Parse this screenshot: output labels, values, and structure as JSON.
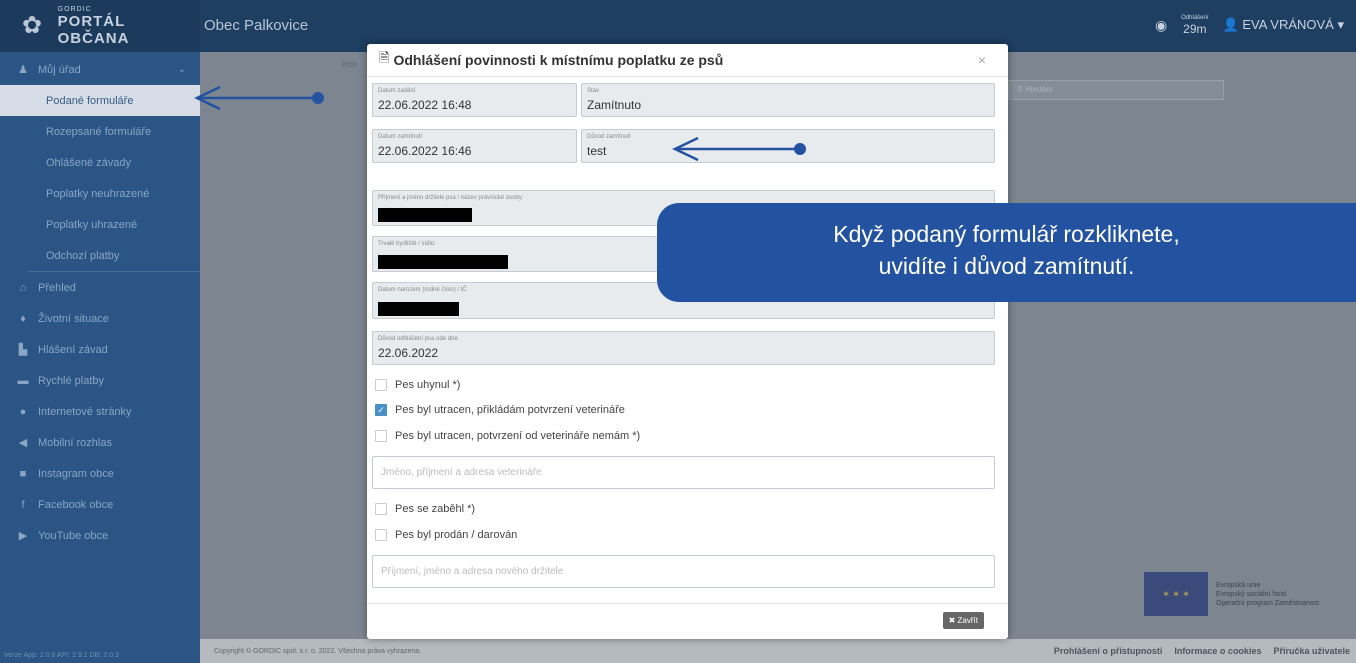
{
  "brand": {
    "small": "GORDIC",
    "name": "PORTÁL OBČANA"
  },
  "header": {
    "town": "Obec Palkovice",
    "timer_label": "Odhlášení",
    "timer_value": "29m",
    "user": "EVA VRÁNOVÁ"
  },
  "sidebar": {
    "items": [
      {
        "icon": "user-icon",
        "label": "Můj úřad"
      },
      {
        "label": "Podané formuláře"
      },
      {
        "label": "Rozepsané formuláře"
      },
      {
        "label": "Ohlášené závady"
      },
      {
        "label": "Poplatky neuhrazené"
      },
      {
        "label": "Poplatky uhrazené"
      },
      {
        "label": "Odchozí platby"
      },
      {
        "icon": "home-icon",
        "label": "Přehled"
      },
      {
        "icon": "lightbulb-icon",
        "label": "Životní situace"
      },
      {
        "icon": "bulldozer-icon",
        "label": "Hlášení závad"
      },
      {
        "icon": "card-icon",
        "label": "Rychlé platby"
      },
      {
        "icon": "globe-icon",
        "label": "Internetové stránky"
      },
      {
        "icon": "megaphone-icon",
        "label": "Mobilní rozhlas"
      },
      {
        "icon": "camera-icon",
        "label": "Instagram obce"
      },
      {
        "icon": "facebook-icon",
        "label": "Facebook obce"
      },
      {
        "icon": "youtube-icon",
        "label": "YouTube obce"
      }
    ],
    "version": "Verze App: 2.0.8 API: 2.9.1 DB: 2.0.3"
  },
  "main": {
    "crumb": "POD",
    "search_placeholder": "Hledání"
  },
  "modal": {
    "title": "Odhlášení povinnosti k místnímu poplatku ze psů",
    "close": "×",
    "date_submitted_label": "Datum zadání",
    "date_submitted": "22.06.2022 16:48",
    "state_label": "Stav",
    "state": "Zamítnuto",
    "date_rejected_label": "Datum zamítnutí",
    "date_rejected": "22.06.2022 16:46",
    "reason_label": "Důvod zamítnutí",
    "reason": "test",
    "owner_label": "Příjmení a jméno držitele psa / název právnické osoby:",
    "address_label": "Trvalé bydliště / sídlo:",
    "birth_label": "Datum narození (rodné číslo) / IČ",
    "dereg_label": "Důvod odhlášení psa ode dne",
    "dereg_date": "22.06.2022",
    "options": [
      {
        "label": "Pes uhynul *)",
        "checked": false
      },
      {
        "label": "Pes byl utracen, přikládám potvrzení veterináře",
        "checked": true
      },
      {
        "label": "Pes byl utracen, potvrzení od veterináře nemám *)",
        "checked": false
      }
    ],
    "vet_placeholder": "Jméno, příjmení a adresa veterináře",
    "options2": [
      {
        "label": "Pes se zaběhl *)",
        "checked": false
      },
      {
        "label": "Pes byl prodán / darován",
        "checked": false
      }
    ],
    "new_owner_placeholder": "Příjmení, jméno a adresa nového držitele",
    "close_button": "Zavřít"
  },
  "callout": {
    "line1": "Když podaný formulář rozkliknete,",
    "line2": "uvidíte i důvod zamítnutí."
  },
  "eu": {
    "line1": "Evropská unie",
    "line2": "Evropský sociální fond",
    "line3": "Operační program Zaměstnanost"
  },
  "footer": {
    "copyright": "Copyright © GORDIC spol. s r. o. 2022. Všechna práva vyhrazena.",
    "links": [
      "Prohlášení o přístupnosti",
      "Informace o cookies",
      "Příručka uživatele"
    ]
  },
  "colors": {
    "accent": "#2353a0",
    "sidebar": "#2a5585",
    "topbar": "#1e3e62"
  }
}
